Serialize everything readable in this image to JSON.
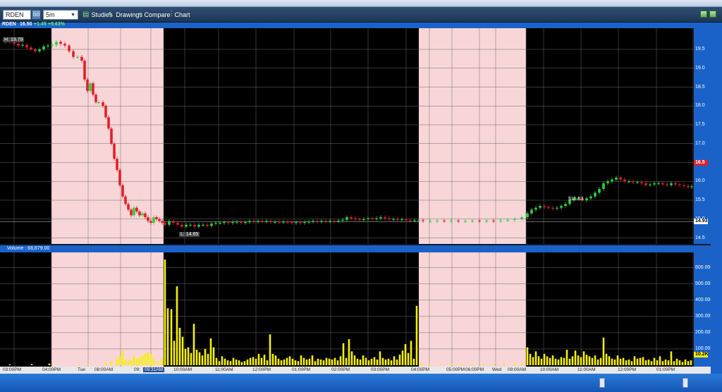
{
  "toolbar": {
    "symbol_value": "RDEN",
    "go_label": "GO",
    "interval_value": "5m",
    "studies_label": "Studies",
    "drawings_label": "Drawings",
    "compare_label": "Compare",
    "chart_label": "Chart"
  },
  "quote": {
    "symbol": "RDEN",
    "price": "16.50",
    "change": "+1.45",
    "change_pct": "+9.63%"
  },
  "annotations": {
    "high_tag": "H: 19.79",
    "low_tag": "L: 14.65",
    "marker_label": "$15.53"
  },
  "price_axis": {
    "ticks": [
      "19.5",
      "19.0",
      "18.5",
      "18.0",
      "17.5",
      "17.0",
      "16.5",
      "16.0",
      "15.5",
      "15.0",
      "14.5"
    ],
    "current_badge": "16.5",
    "last_badge": "14.93"
  },
  "volume": {
    "header": "Volume : 68,679.00",
    "ticks": [
      "600.00K",
      "500.00K",
      "400.00K",
      "300.00K",
      "200.00K",
      "100.00K"
    ],
    "badge": "10.2K"
  },
  "time_axis": {
    "labels": [
      "03:00PM",
      "04:00PM",
      "Tue",
      "08:00AM",
      "09:",
      "09:31AM",
      "10:00AM",
      "11:00AM",
      "12:00PM",
      "01:00PM",
      "02:00PM",
      "03:00PM",
      "04:00PM",
      "05:00PM",
      "06:00PM",
      "Wed",
      "09:00AM",
      "10:00AM",
      "11:00AM",
      "12:00PM",
      "01:00PM"
    ],
    "highlighted": "09:31AM"
  },
  "colors": {
    "up": "#2fcf3f",
    "down": "#e0202a",
    "volume": "#f6f00a",
    "extended_hours": "#f8d6d8",
    "panel": "#1a62c8"
  }
}
